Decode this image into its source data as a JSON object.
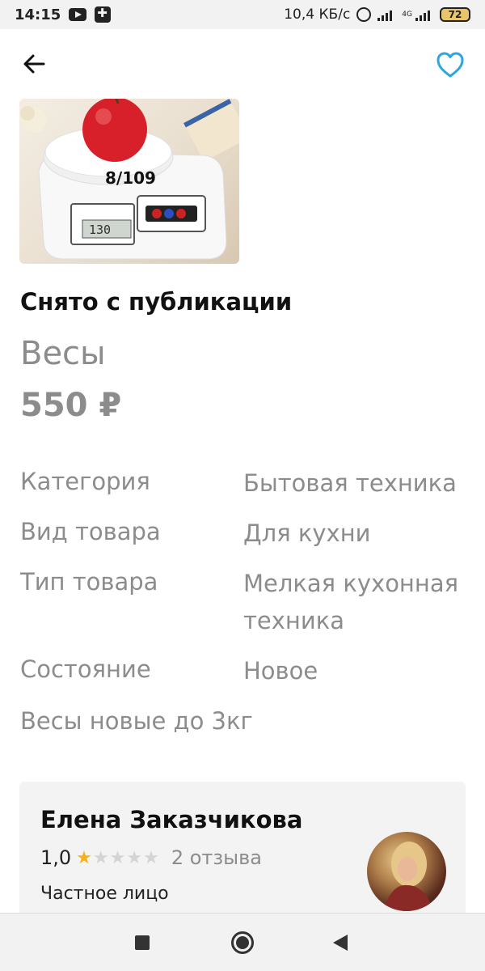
{
  "status_bar": {
    "time": "14:15",
    "network_speed": "10,4 КБ/с",
    "network_type": "4G",
    "battery": "72",
    "icons": [
      "youtube-icon",
      "app-icon",
      "alarm-icon",
      "signal-icon",
      "battery-icon"
    ]
  },
  "header": {
    "back_icon": "arrow-left-icon",
    "favorite_icon": "heart-outline-icon",
    "accent_color": "#2aa6e0"
  },
  "product": {
    "image_caption": "8/109",
    "scale_display": "130",
    "status": "Снято с публикации",
    "title": "Весы",
    "price": "550 ₽",
    "attributes": [
      {
        "label": "Категория",
        "value": "Бытовая техника"
      },
      {
        "label": "Вид товара",
        "value": "Для кухни"
      },
      {
        "label": "Тип товара",
        "value": "Мелкая кухонная техника"
      },
      {
        "label": "Состояние",
        "value": "Новое"
      }
    ],
    "description": "Весы новые до 3кг"
  },
  "seller": {
    "name": "Елена Заказчикова",
    "rating": "1,0",
    "rating_value": 1,
    "rating_max": 5,
    "reviews": "2 отзыва",
    "type": "Частное лицо",
    "star_color": "#f5b01a"
  },
  "nav": {
    "icons": [
      "recents-square-icon",
      "home-circle-icon",
      "back-triangle-icon"
    ]
  }
}
